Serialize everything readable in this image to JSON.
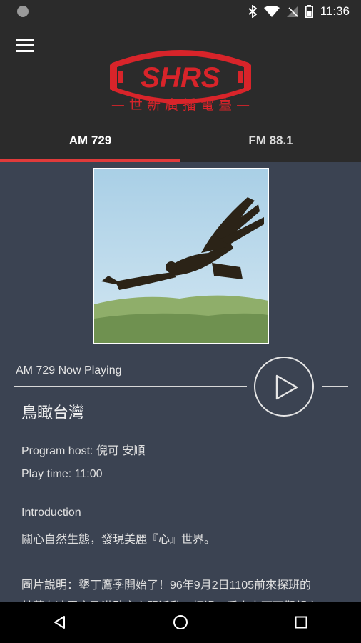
{
  "status_bar": {
    "time": "11:36"
  },
  "header": {
    "logo_text": "SHRS",
    "subtitle": "— 世 新 廣 播 電 臺 —"
  },
  "tabs": [
    {
      "label": "AM 729",
      "active": true
    },
    {
      "label": "FM 88.1",
      "active": false
    }
  ],
  "player": {
    "now_playing_label": "AM 729 Now Playing",
    "program_title": "鳥瞰台灣",
    "host": "Program host: 倪可 安順",
    "play_time": "Play time: 11:00",
    "intro_label": "Introduction",
    "intro_text": "關心自然生態，發現美麗『心』世界。",
    "caption_line1": "圖片說明：墾丁鷹季開始了！96年9月2日1105前來探班的",
    "caption_line2": "赫蘭在凌霄亭及港駐亭之間活動，經過一番上上下下觀望之"
  },
  "colors": {
    "accent": "#e03b3b",
    "background": "#3b4352",
    "toolbar": "#2b2b2b"
  },
  "icons": {
    "menu": "hamburger-icon",
    "play": "play-icon",
    "back": "back-triangle-icon",
    "home": "home-circle-icon",
    "recents": "recents-square-icon"
  }
}
